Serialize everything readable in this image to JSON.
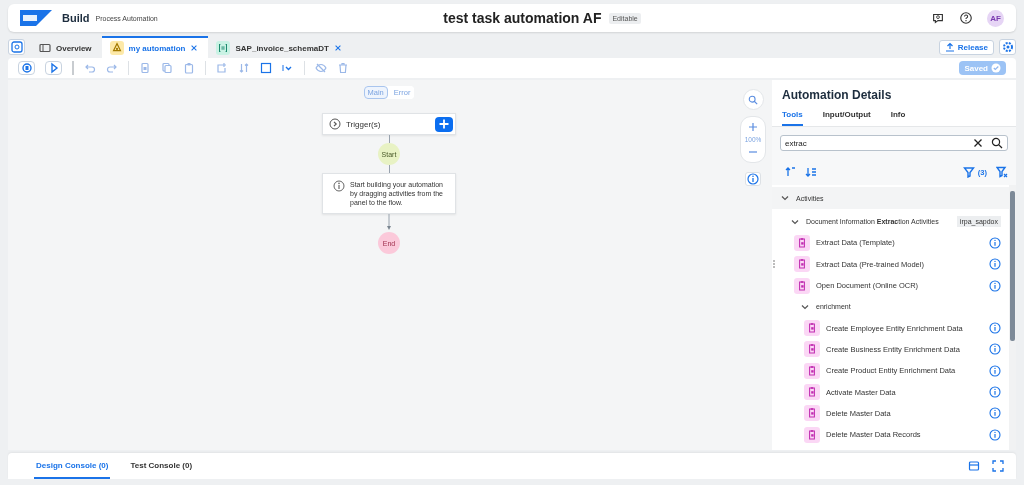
{
  "header": {
    "brand": "Build",
    "product": "Process Automation",
    "title": "test task automation AF",
    "badge": "Editable",
    "avatar": "AF"
  },
  "tabs": [
    {
      "label": "Overview",
      "selected": false,
      "kind": "overview"
    },
    {
      "label": "my automation",
      "selected": true,
      "kind": "automation"
    },
    {
      "label": "SAP_invoice_schemaDT",
      "selected": false,
      "kind": "datatype"
    }
  ],
  "release_button": "Release",
  "saved_button": "Saved",
  "flow_tabs": [
    {
      "label": "Main",
      "selected": true
    },
    {
      "label": "Error",
      "selected": false
    }
  ],
  "flow": {
    "trigger": "Trigger(s)",
    "start": "Start",
    "hint": "Start building your automation by dragging activities from the panel to the flow.",
    "end": "End"
  },
  "zoom_level": "100%",
  "panel": {
    "title": "Automation Details",
    "tabs": [
      {
        "label": "Tools",
        "selected": true
      },
      {
        "label": "Input/Output",
        "selected": false
      },
      {
        "label": "Info",
        "selected": false
      }
    ],
    "search": {
      "value": "extrac"
    },
    "filter_count": "(3)",
    "tree": [
      {
        "kind": "group",
        "label": "Activities",
        "expanded": true,
        "children": [
          {
            "kind": "group",
            "label": "Document Information **Extrac**tion Activities",
            "tag": "irpa_sapdox",
            "expanded": true,
            "children": [
              {
                "kind": "activity",
                "label": "Extract Data (Template)"
              },
              {
                "kind": "activity",
                "label": "Extract Data (Pre-trained Model)"
              },
              {
                "kind": "activity",
                "label": "Open Document (Online OCR)"
              },
              {
                "kind": "group",
                "label": "enrichment",
                "expanded": true,
                "children": [
                  {
                    "kind": "activity",
                    "label": "Create Employee Entity Enrichment Data"
                  },
                  {
                    "kind": "activity",
                    "label": "Create Business Entity Enrichment Data"
                  },
                  {
                    "kind": "activity",
                    "label": "Create Product Entity Enrichment Data"
                  },
                  {
                    "kind": "activity",
                    "label": "Activate Master Data"
                  },
                  {
                    "kind": "activity",
                    "label": "Delete Master Data"
                  },
                  {
                    "kind": "activity",
                    "label": "Delete Master Data Records"
                  }
                ]
              }
            ]
          }
        ]
      }
    ]
  },
  "console_tabs": [
    {
      "label": "Design Console (0)",
      "selected": true
    },
    {
      "label": "Test Console (0)",
      "selected": false
    }
  ]
}
